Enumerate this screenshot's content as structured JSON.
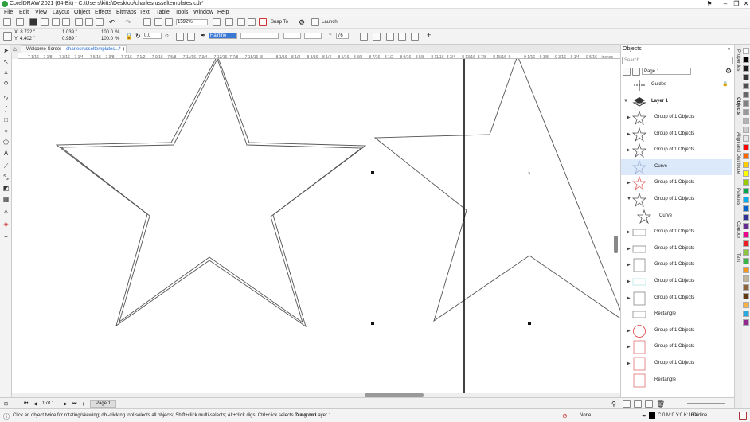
{
  "window": {
    "title": "CorelDRAW 2021 (64-Bit) - C:\\Users\\kitts\\Desktop\\charlesrusseltemplates.cdr*"
  },
  "menu": [
    "File",
    "Edit",
    "View",
    "Layout",
    "Object",
    "Effects",
    "Bitmaps",
    "Text",
    "Table",
    "Tools",
    "Window",
    "Help"
  ],
  "toolbar": {
    "zoom": "1592%",
    "snap_to": "Snap To",
    "launch": "Launch"
  },
  "propbar": {
    "x": "X: 8.722 \"",
    "y": "Y: 4.402 \"",
    "w": "1.039 \"",
    "h": "0.989 \"",
    "sx": "100.0",
    "sy": "100.0",
    "pct": "%",
    "angle": "0.0",
    "outline": "Hairline",
    "smooth": "76"
  },
  "tabs": [
    {
      "label": "Welcome Screen"
    },
    {
      "label": "charlesrusseltemplates...*"
    }
  ],
  "ruler_labels": [
    "7 1/16",
    "7 1/8",
    "7 3/16",
    "7 1/4",
    "7 5/16",
    "7 3/8",
    "7 7/16",
    "7 1/2",
    "7 9/16",
    "7 5/8",
    "7 11/16",
    "7 3/4",
    "7 13/16",
    "7 7/8",
    "7 15/16",
    "8",
    "8 1/16",
    "8 1/8",
    "8 3/16",
    "8 1/4",
    "8 5/16",
    "8 3/8",
    "8 7/16",
    "8 1/2",
    "8 9/16",
    "8 5/8",
    "8 11/16",
    "8 3/4",
    "8 13/16",
    "8 7/8",
    "8 15/16",
    "9",
    "9 1/16",
    "9 1/8",
    "9 3/16",
    "9 1/4",
    "9 5/16",
    "inches"
  ],
  "pagebar": {
    "counter": "1 of 1",
    "page_tab": "Page 1"
  },
  "status": {
    "hint": "Click an object twice for rotating/skewing; dbl-clicking tool selects all objects; Shift+click multi-selects; Alt+click digs; Ctrl+click selects in a group",
    "selection": "Curve on Layer 1",
    "fill": "None",
    "outline_color": "C:0 M:0 Y:0 K:100",
    "outline_width": "Hairline"
  },
  "objects_panel": {
    "title": "Objects",
    "search_placeholder": "Search",
    "page": "Page 1",
    "guides": "Guides",
    "layer": "Layer 1",
    "items": [
      {
        "label": "Group of 1 Objects",
        "shape": "star",
        "color": "#555555"
      },
      {
        "label": "Group of 1 Objects",
        "shape": "star",
        "color": "#555555"
      },
      {
        "label": "Group of 1 Objects",
        "shape": "star",
        "color": "#555555"
      },
      {
        "label": "Curve",
        "shape": "star",
        "color": "#9aaed0"
      },
      {
        "label": "Group of 1 Objects",
        "shape": "star",
        "color": "#e06060"
      },
      {
        "label": "Group of 1 Objects",
        "shape": "star",
        "color": "#555555"
      },
      {
        "label": "Curve",
        "shape": "star",
        "color": "#555555"
      },
      {
        "label": "Group of 1 Objects",
        "shape": "rect",
        "color": "#888888"
      },
      {
        "label": "Group of 1 Objects",
        "shape": "rect",
        "color": "#888888"
      },
      {
        "label": "Group of 1 Objects",
        "shape": "rect",
        "color": "#888888"
      },
      {
        "label": "Group of 1 Objects",
        "shape": "rect",
        "color": "#b7e6e6"
      },
      {
        "label": "Group of 1 Objects",
        "shape": "rect",
        "color": "#888888"
      },
      {
        "label": "Rectangle",
        "shape": "rect",
        "color": "#888888"
      },
      {
        "label": "Group of 1 Objects",
        "shape": "circle",
        "color": "#e03a3a"
      },
      {
        "label": "Group of 1 Objects",
        "shape": "rect",
        "color": "#e07070"
      },
      {
        "label": "Group of 1 Objects",
        "shape": "rect",
        "color": "#e07070"
      },
      {
        "label": "Rectangle",
        "shape": "rect",
        "color": "#e07070"
      }
    ]
  },
  "dock_tabs": [
    "Properties",
    "Objects",
    "Align and Distribute",
    "Palettes",
    "Contour",
    "Text"
  ],
  "palette": [
    "#ffffff",
    "#000000",
    "#1a1a1a",
    "#333333",
    "#4d4d4d",
    "#666666",
    "#808080",
    "#999999",
    "#b3b3b3",
    "#cccccc",
    "#e6e6e6",
    "#ff0000",
    "#ff6600",
    "#ffcc00",
    "#ffff00",
    "#99cc00",
    "#00a650",
    "#00aeef",
    "#0066cc",
    "#2e3192",
    "#662d91",
    "#ec008c",
    "#ed1c24",
    "#8dc63f",
    "#39b54a",
    "#f7941d",
    "#c2b59b",
    "#8c6239",
    "#603913",
    "#fbb040",
    "#27aae1",
    "#92278f"
  ]
}
